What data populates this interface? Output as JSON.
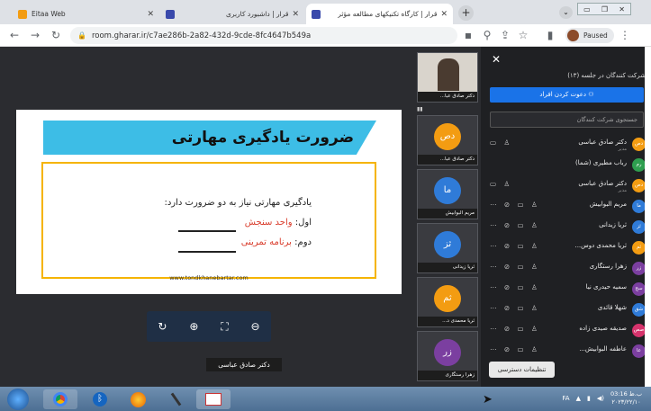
{
  "tabs": [
    {
      "title": "Eitaa Web",
      "color": "#f39c12"
    },
    {
      "title": "قرار | داشبورد کاربری",
      "color": "#3949ab"
    },
    {
      "title": "قرار | کارگاه تکنیکهای مطالعه مؤثر",
      "color": "#3949ab"
    }
  ],
  "toolbar": {
    "url": "room.gharar.ir/c7ae286b-2a82-432d-9cde-8fc4647b549a",
    "paused_label": "Paused"
  },
  "slide": {
    "title": "ضرورت یادگیری مهارتی",
    "line1": "یادگیری مهارتی نیاز به دو ضرورت دارد:",
    "line2_prefix": "اول: ",
    "line2_value": "واحد سنجش",
    "line3_prefix": "دوم: ",
    "line3_value": "برنامه تمرینی",
    "site": "www.tondkhanebartar.com"
  },
  "controls": [
    "↻",
    "⊕",
    "⛶",
    "⊖"
  ],
  "speaker_label": "دکتر صادق عباسی",
  "video_tiles": [
    {
      "name": "دکتر صادق عبا...",
      "initials": "",
      "color": "#6b5a4a"
    },
    {
      "name": "دکتر صادق عبا...",
      "initials": "دص",
      "color": "#f39c12"
    },
    {
      "name": "مریم البوابیش",
      "initials": "ما",
      "color": "#2f7bd8"
    },
    {
      "name": "ثریا زیدانی",
      "initials": "ثز",
      "color": "#2f7bd8"
    },
    {
      "name": "ثریا محمدی د...",
      "initials": "ثم",
      "color": "#f39c12"
    },
    {
      "name": "زهرا رستگاری",
      "initials": "زر",
      "color": "#7b3fa0"
    }
  ],
  "panel": {
    "heading": "شرکت کنندگان در جلسه (۱۳)",
    "invite_label": "دعوت کردن افراد",
    "search_placeholder": "جستجوی شرکت کنندگان",
    "access_label": "تنظیمات دسترسی",
    "participants": [
      {
        "name": "دکتر صادق عباسی",
        "role": "مدیر",
        "initials": "دص",
        "color": "#f39c12",
        "icons": "▭ ♙"
      },
      {
        "name": "رباب مطیری (شما)",
        "role": "",
        "initials": "رم",
        "color": "#2e9e4f",
        "icons": ""
      },
      {
        "name": "دکتر صادق عباسی",
        "role": "مدیر",
        "initials": "دص",
        "color": "#f39c12",
        "icons": "▭ ♙"
      },
      {
        "name": "مریم البوابیش",
        "role": "",
        "initials": "ما",
        "color": "#2f7bd8",
        "icons": "⋯ ⊘ ▭ ♙"
      },
      {
        "name": "ثریا زیدانی",
        "role": "",
        "initials": "ثز",
        "color": "#2f7bd8",
        "icons": "⋯ ⊘ ▭ ♙"
      },
      {
        "name": "ثریا محمدی دوس...",
        "role": "",
        "initials": "ثم",
        "color": "#f39c12",
        "icons": "⋯ ⊘ ▭ ♙"
      },
      {
        "name": "زهرا رستگاری",
        "role": "",
        "initials": "زر",
        "color": "#7b3fa0",
        "icons": "⋯ ⊘ ▭ ♙"
      },
      {
        "name": "سمیه حیدری نیا",
        "role": "",
        "initials": "سح",
        "color": "#7b3fa0",
        "icons": "⋯ ⊘ ▭ ♙"
      },
      {
        "name": "شهلا قائدی",
        "role": "",
        "initials": "شق",
        "color": "#2f7bd8",
        "icons": "⋯ ⊘ ▭ ♙"
      },
      {
        "name": "صدیقه صیدی زاده",
        "role": "",
        "initials": "صص",
        "color": "#d6336c",
        "icons": "⋯ ⊘ ▭ ♙"
      },
      {
        "name": "عاطفه البوابیش...",
        "role": "",
        "initials": "عا",
        "color": "#7b3fa0",
        "icons": "⋯ ⊘ ▭ ♙"
      }
    ]
  },
  "taskbar": {
    "lang": "FA",
    "time": "03:16 ب.ظ",
    "date": "۲۰۲۳/۲۲/۱۰"
  }
}
